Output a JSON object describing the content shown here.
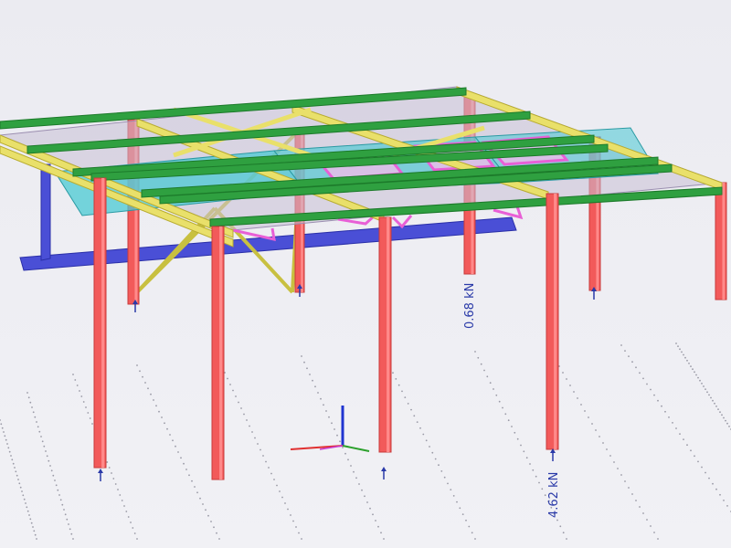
{
  "viewport": {
    "background": "#eeeef3",
    "colors": {
      "column": "#f25a5a",
      "column_edge": "#c83b3b",
      "primary_beam": "#e9e06a",
      "secondary_beam": "#2fa040",
      "bracing": "#c8c040",
      "blue_member": "#4a4fd6",
      "magenta_member": "#e85fd6",
      "cyan_panel": "#49c9d3",
      "roof_panel": "#c8c0d6",
      "support_arrow": "#2a3aa8",
      "axis_x": "#e03030",
      "axis_y": "#2ca02c",
      "axis_z": "#2035d0"
    }
  },
  "support_reactions": [
    {
      "label": "0.68 kN"
    },
    {
      "label": "4.62 kN"
    }
  ],
  "axis_icons": [
    "x-axis",
    "y-axis",
    "z-axis"
  ]
}
